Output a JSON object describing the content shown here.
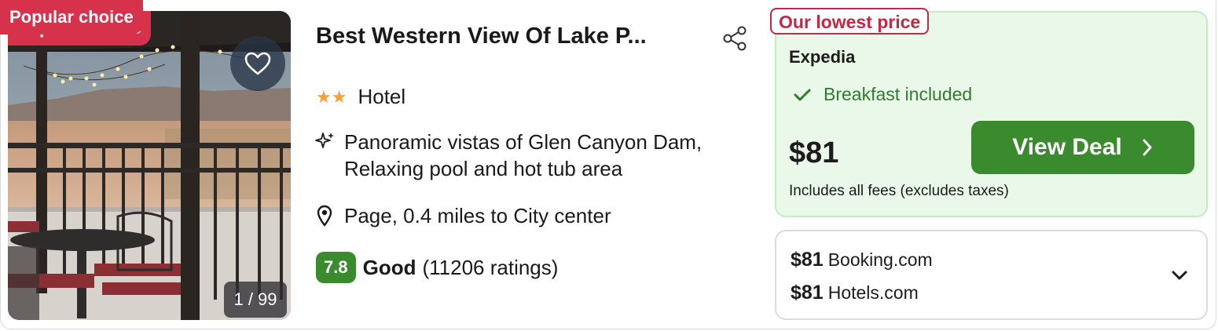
{
  "listing": {
    "badge": "Popular choice",
    "photo_counter": "1 / 99",
    "title": "Best Western View Of Lake P...",
    "stars_glyph": "★★",
    "star_count": 2,
    "type": "Hotel",
    "highlights_line1": "Panoramic vistas of Glen Canyon Dam,",
    "highlights_line2": "Relaxing pool and hot tub area",
    "location": "Page, 0.4 miles to City center",
    "rating_score": "7.8",
    "rating_word": "Good",
    "rating_count": "(11206 ratings)"
  },
  "deal": {
    "tag": "Our lowest price",
    "provider": "Expedia",
    "amenity": "Breakfast included",
    "price": "$81",
    "fees_note": "Includes all fees (excludes taxes)",
    "cta": "View Deal"
  },
  "other_offers": [
    {
      "price": "$81",
      "provider": "Booking.com"
    },
    {
      "price": "$81",
      "provider": "Hotels.com"
    }
  ],
  "colors": {
    "brand_green": "#3a8a2e",
    "badge_red": "#d6324c",
    "deal_bg": "#eaf8ea",
    "star_orange": "#f5a13a"
  },
  "icons": [
    "heart-icon",
    "share-icon",
    "star-icon",
    "sparkle-icon",
    "map-pin-icon",
    "check-icon",
    "chevron-right-icon",
    "chevron-down-icon"
  ]
}
